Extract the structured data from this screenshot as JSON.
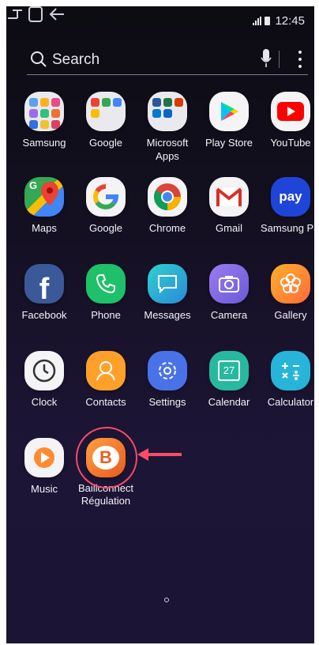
{
  "status": {
    "time": "12:45"
  },
  "search": {
    "placeholder": "Search"
  },
  "apps": [
    {
      "label": "Samsung"
    },
    {
      "label": "Google"
    },
    {
      "label": "Microsoft Apps"
    },
    {
      "label": "Play Store"
    },
    {
      "label": "YouTube"
    },
    {
      "label": "Maps"
    },
    {
      "label": "Google"
    },
    {
      "label": "Chrome"
    },
    {
      "label": "Gmail"
    },
    {
      "label": "Samsung Pay"
    },
    {
      "label": "Facebook"
    },
    {
      "label": "Phone"
    },
    {
      "label": "Messages"
    },
    {
      "label": "Camera"
    },
    {
      "label": "Gallery"
    },
    {
      "label": "Clock"
    },
    {
      "label": "Contacts"
    },
    {
      "label": "Settings"
    },
    {
      "label": "Calendar"
    },
    {
      "label": "Calculator"
    },
    {
      "label": "Music"
    },
    {
      "label": "Baillconnect Régulation"
    }
  ],
  "calendar_day": "27",
  "pay_text": "pay",
  "colors": {
    "highlight": "#ff4a6a",
    "accent_orange": "#f07a2a"
  }
}
